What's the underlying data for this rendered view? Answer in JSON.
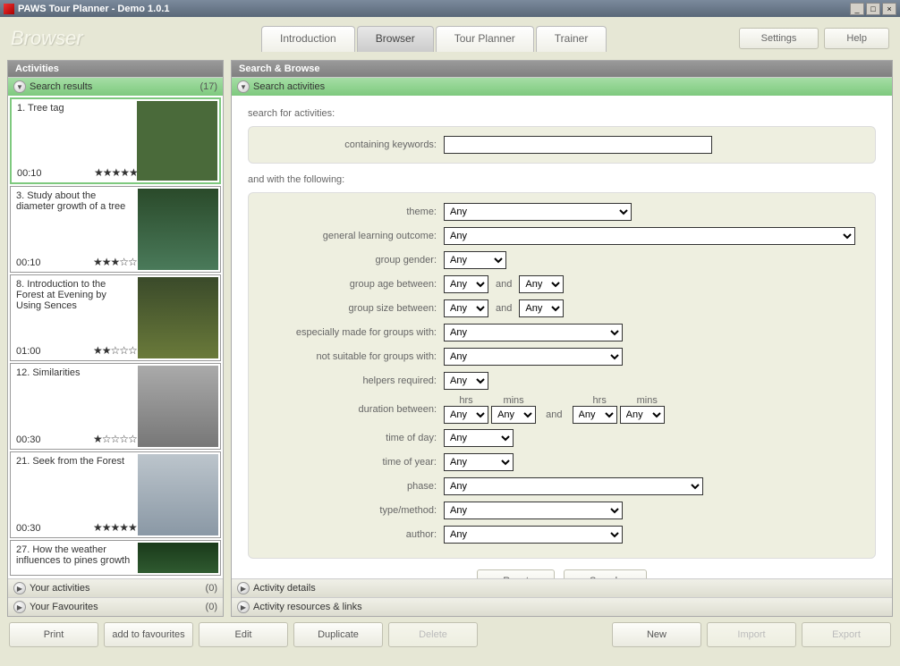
{
  "window": {
    "title": "PAWS Tour Planner - Demo 1.0.1",
    "app_title": "Browser"
  },
  "tabs": [
    {
      "label": "Introduction",
      "active": false
    },
    {
      "label": "Browser",
      "active": true
    },
    {
      "label": "Tour Planner",
      "active": false
    },
    {
      "label": "Trainer",
      "active": false
    }
  ],
  "header_buttons": {
    "settings": "Settings",
    "help": "Help"
  },
  "left": {
    "panel_title": "Activities",
    "sections": {
      "results": {
        "label": "Search results",
        "count": "(17)",
        "open": true
      },
      "your": {
        "label": "Your activities",
        "count": "(0)",
        "open": false
      },
      "fav": {
        "label": "Your Favourites",
        "count": "(0)",
        "open": false
      }
    },
    "items": [
      {
        "title": "1. Tree tag",
        "time": "00:10",
        "stars": "★★★★★",
        "selected": true,
        "thumb": "#3a6a2a"
      },
      {
        "title": "3. Study about the diameter growth of a tree",
        "time": "00:10",
        "stars": "★★★☆☆",
        "selected": false,
        "thumb": "#2f5a3a"
      },
      {
        "title": "8. Introduction to the Forest at Evening by Using Sences",
        "time": "01:00",
        "stars": "★★☆☆☆",
        "selected": false,
        "thumb": "#6a7a3a"
      },
      {
        "title": "12. Similarities",
        "time": "00:30",
        "stars": "★☆☆☆☆",
        "selected": false,
        "thumb": "#9aa5a8"
      },
      {
        "title": "21. Seek from the Forest",
        "time": "00:30",
        "stars": "★★★★★",
        "selected": false,
        "thumb": "#aab5bc"
      },
      {
        "title": "27. How the weather influences to pines growth",
        "time": "",
        "stars": "",
        "selected": false,
        "thumb": "#1f3a20"
      }
    ]
  },
  "right": {
    "panel_title": "Search & Browse",
    "section_label": "Search activities",
    "search_for": "search for activities:",
    "kw_label": "containing keywords:",
    "kw_value": "",
    "and_with": "and with the following:",
    "fields": {
      "theme": {
        "label": "theme:",
        "value": "Any"
      },
      "glo": {
        "label": "general learning outcome:",
        "value": "Any"
      },
      "gender": {
        "label": "group gender:",
        "value": "Any"
      },
      "age": {
        "label": "group age between:",
        "a": "Any",
        "b": "Any",
        "conj": "and"
      },
      "size": {
        "label": "group size between:",
        "a": "Any",
        "b": "Any",
        "conj": "and"
      },
      "esp": {
        "label": "especially made for groups with:",
        "value": "Any"
      },
      "notsuit": {
        "label": "not suitable for groups with:",
        "value": "Any"
      },
      "helpers": {
        "label": "helpers required:",
        "value": "Any"
      },
      "duration": {
        "label": "duration between:",
        "hrs_a": "Any",
        "min_a": "Any",
        "hrs_b": "Any",
        "min_b": "Any",
        "conj": "and",
        "hrs_hdr": "hrs",
        "min_hdr": "mins"
      },
      "tod": {
        "label": "time of day:",
        "value": "Any"
      },
      "toy": {
        "label": "time of year:",
        "value": "Any"
      },
      "phase": {
        "label": "phase:",
        "value": "Any"
      },
      "type": {
        "label": "type/method:",
        "value": "Any"
      },
      "author": {
        "label": "author:",
        "value": "Any"
      }
    },
    "buttons": {
      "reset": "Reset",
      "search": "Search"
    },
    "sub_sections": {
      "details": "Activity details",
      "res": "Activity resources & links"
    }
  },
  "footer": {
    "print": "Print",
    "addfav": "add to favourites",
    "edit": "Edit",
    "duplicate": "Duplicate",
    "delete": "Delete",
    "new": "New",
    "import": "Import",
    "export": "Export"
  }
}
